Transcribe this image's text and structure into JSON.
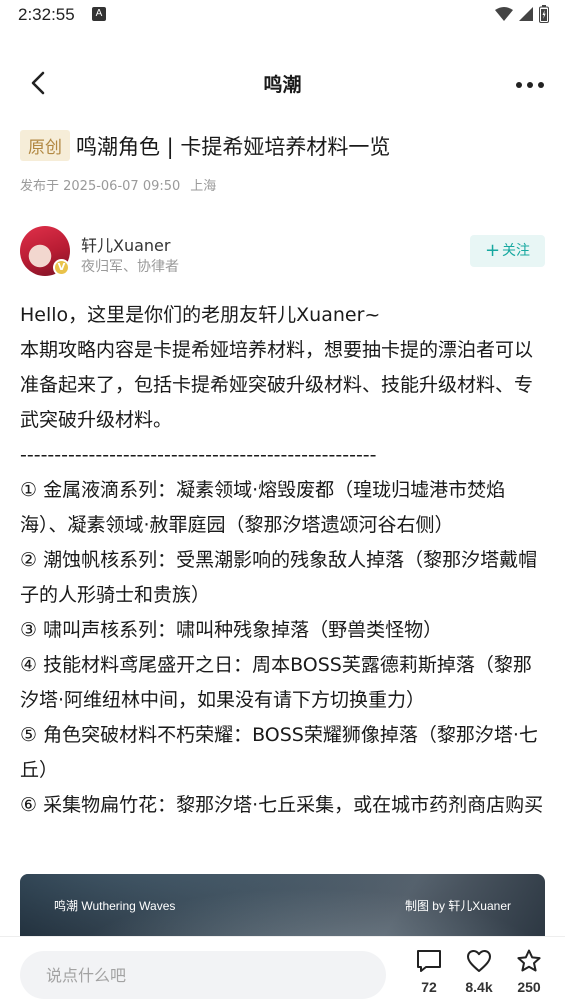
{
  "status_bar": {
    "time": "2:32:55",
    "notification_glyph": "A",
    "icons": [
      "wifi-icon",
      "signal-icon",
      "battery-icon"
    ]
  },
  "nav": {
    "title": "鸣潮",
    "back_icon": "chevron-left-icon",
    "more_icon": "more-horizontal-icon"
  },
  "article": {
    "tag": "原创",
    "title": "鸣潮角色 | 卡提希娅培养材料一览",
    "published": "发布于 2025-06-07 09:50",
    "location": "上海"
  },
  "author": {
    "name": "轩儿Xuaner",
    "roles": "夜归军、协律者",
    "follow_label": "关注",
    "follow_icon": "plus-icon"
  },
  "body": {
    "paragraphs": [
      "Hello，这里是你们的老朋友轩儿Xuaner~",
      "本期攻略内容是卡提希娅培养材料，想要抽卡提的漂泊者可以准备起来了，包括卡提希娅突破升级材料、技能升级材料、专武突破升级材料。",
      "----------------------------------------------------",
      "① 金属液滴系列：凝素领域·熔毁废都（瑝珑归墟港市焚焰海）、凝素领域·赦罪庭园（黎那汐塔遗颂河谷右侧）",
      "② 潮蚀帆核系列：受黑潮影响的残象敌人掉落（黎那汐塔戴帽子的人形骑士和贵族）",
      "③ 啸叫声核系列：啸叫种残象掉落（野兽类怪物）",
      "④ 技能材料鸢尾盛开之日：周本BOSS芙露德莉斯掉落（黎那汐塔·阿维纽林中间，如果没有请下方切换重力）",
      "⑤ 角色突破材料不朽荣耀：BOSS荣耀狮像掉落（黎那汐塔·七丘）",
      "⑥ 采集物扁竹花：黎那汐塔·七丘采集，或在城市药剂商店购买"
    ]
  },
  "banner": {
    "left_text": "鸣潮 Wuthering Waves",
    "right_text": "制图 by 轩儿Xuaner"
  },
  "bottom_bar": {
    "comment_placeholder": "说点什么吧",
    "comments_count": "72",
    "likes_count": "8.4k",
    "favorites_count": "250",
    "accent_color": "#17a8a0"
  }
}
